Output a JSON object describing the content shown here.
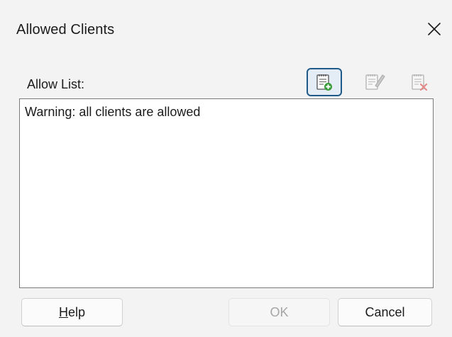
{
  "dialog": {
    "title": "Allowed Clients",
    "close_icon": "close-icon"
  },
  "allow_list": {
    "label": "Allow List:",
    "items": [
      "Warning: all clients are allowed"
    ]
  },
  "toolbar": {
    "add_icon": "add-entry-icon",
    "edit_icon": "edit-entry-icon",
    "delete_icon": "delete-entry-icon"
  },
  "buttons": {
    "help_mnemonic": "H",
    "help_rest": "elp",
    "ok": "OK",
    "cancel": "Cancel"
  },
  "colors": {
    "accent_border": "#1e5a8a",
    "accent_fill": "#e4ecf5",
    "disabled_text": "#a6a6a6"
  }
}
